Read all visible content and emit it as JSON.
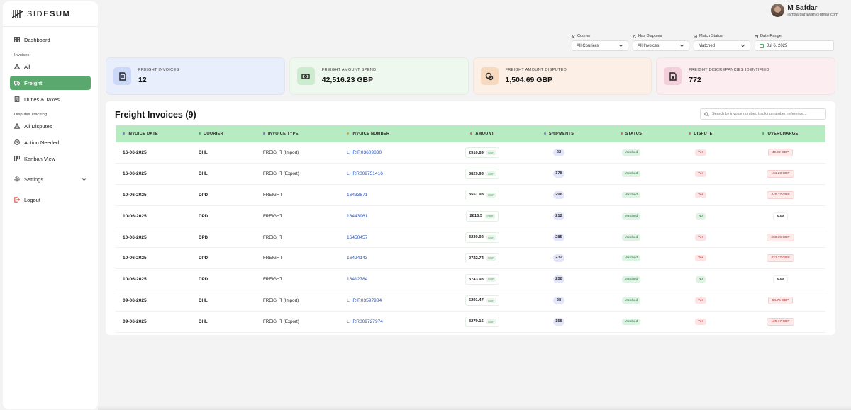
{
  "logo": {
    "text_light": "SIDE",
    "text_bold": "SUM"
  },
  "sidebar": {
    "dashboard": "Dashboard",
    "invoices_section": "Invoices",
    "all": "All",
    "freight": "Freight",
    "duties": "Duties & Taxes",
    "disputes_section": "Disputes Tracking",
    "all_disputes": "All Disputes",
    "action_needed": "Action Needed",
    "kanban": "Kanban View",
    "settings": "Settings",
    "logout": "Logout"
  },
  "user": {
    "name": "M Safdar",
    "email": "iamsafdarawan@gmail.com"
  },
  "filters": {
    "courier": {
      "label": "Courier",
      "value": "All Couriers"
    },
    "disputes": {
      "label": "Has Disputes",
      "value": "All Invoices"
    },
    "match": {
      "label": "Match Status",
      "value": "Matched"
    },
    "date": {
      "label": "Date Range",
      "value": "Jul 6, 2025"
    }
  },
  "cards": [
    {
      "label": "FREIGHT INVOICES",
      "value": "12"
    },
    {
      "label": "FREIGHT AMOUNT SPEND",
      "value": "42,516.23 GBP"
    },
    {
      "label": "FREIGHT AMOUNT DISPUTED",
      "value": "1,504.69 GBP"
    },
    {
      "label": "FREIGHT DISCREPANCIES IDENTIFIED",
      "value": "772"
    }
  ],
  "panel": {
    "title": "Freight Invoices (9)",
    "search_placeholder": "Search by invoice number, tracking number, reference..."
  },
  "table": {
    "headers": [
      "INVOICE DATE",
      "COURIER",
      "INVOICE TYPE",
      "INVOICE NUMBER",
      "AMOUNT",
      "SHIPMENTS",
      "STATUS",
      "DISPUTE",
      "OVERCHARGE"
    ],
    "header_dot_colors": [
      "#6b7fd8",
      "#5aa86d",
      "#8a6bd8",
      "#e0a030",
      "#e06060",
      "#6b7fd8",
      "#e06060",
      "#e06060",
      "#5aa86d"
    ],
    "currency": "GBP",
    "rows": [
      {
        "date": "16-06-2025",
        "courier": "DHL",
        "type": "FREIGHT (Import)",
        "number": "LHRIR03609830",
        "amount": "2510.89",
        "shipments": "22",
        "status": "Matched",
        "dispute": "Yes",
        "overcharge": "49.92 GBP"
      },
      {
        "date": "16-06-2025",
        "courier": "DHL",
        "type": "FREIGHT (Export)",
        "number": "LHRR009751416",
        "amount": "3829.93",
        "shipments": "178",
        "status": "Matched",
        "dispute": "Yes",
        "overcharge": "151.23 GBP"
      },
      {
        "date": "10-06-2025",
        "courier": "DPD",
        "type": "FREIGHT",
        "number": "16433871",
        "amount": "3551.98",
        "shipments": "296",
        "status": "Matched",
        "dispute": "Yes",
        "overcharge": "440.17 GBP"
      },
      {
        "date": "10-06-2025",
        "courier": "DPD",
        "type": "FREIGHT",
        "number": "16443961",
        "amount": "2815.5",
        "shipments": "212",
        "status": "Matched",
        "dispute": "No",
        "overcharge": "0.00"
      },
      {
        "date": "10-06-2025",
        "courier": "DPD",
        "type": "FREIGHT",
        "number": "16450457",
        "amount": "3230.92",
        "shipments": "285",
        "status": "Matched",
        "dispute": "Yes",
        "overcharge": "360.39 GBP"
      },
      {
        "date": "10-06-2025",
        "courier": "DPD",
        "type": "FREIGHT",
        "number": "16424143",
        "amount": "2722.74",
        "shipments": "232",
        "status": "Matched",
        "dispute": "Yes",
        "overcharge": "321.77 GBP"
      },
      {
        "date": "10-06-2025",
        "courier": "DPD",
        "type": "FREIGHT",
        "number": "16412784",
        "amount": "3743.93",
        "shipments": "258",
        "status": "Matched",
        "dispute": "No",
        "overcharge": "0.00"
      },
      {
        "date": "09-06-2025",
        "courier": "DHL",
        "type": "FREIGHT (Import)",
        "number": "LHRIR03597984",
        "amount": "5291.47",
        "shipments": "28",
        "status": "Matched",
        "dispute": "Yes",
        "overcharge": "54.76 GBP"
      },
      {
        "date": "09-06-2025",
        "courier": "DHL",
        "type": "FREIGHT (Export)",
        "number": "LHRR009727974",
        "amount": "3279.16",
        "shipments": "158",
        "status": "Matched",
        "dispute": "Yes",
        "overcharge": "125.17 GBP"
      }
    ]
  }
}
